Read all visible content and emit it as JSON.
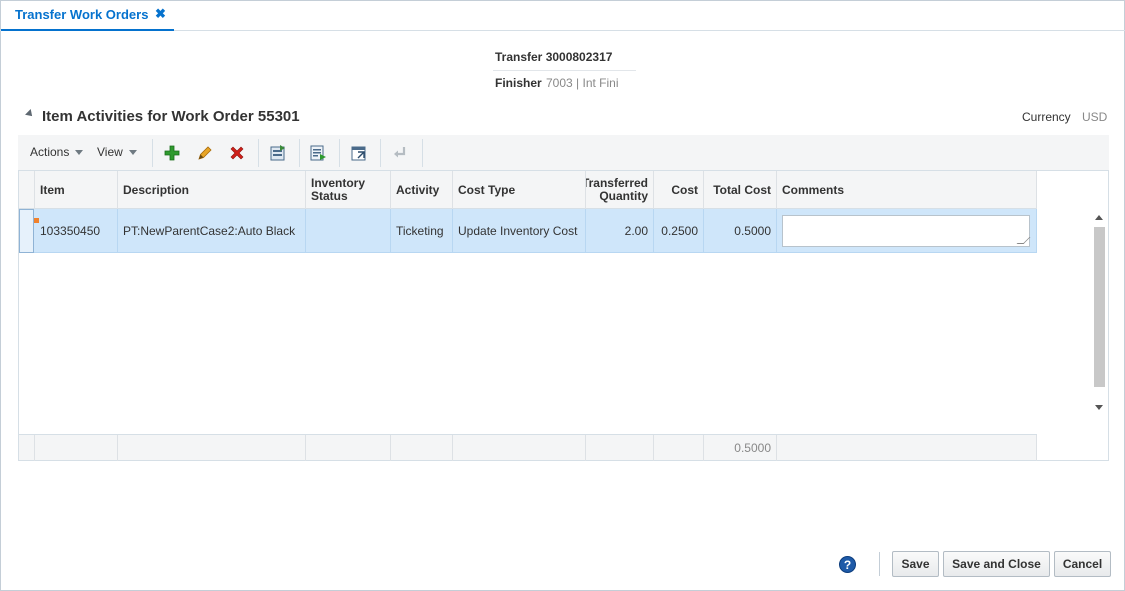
{
  "tab": {
    "title": "Transfer Work Orders",
    "close": "✖"
  },
  "header": {
    "transfer": "Transfer 3000802317",
    "finisher_label": "Finisher",
    "finisher_value": "7003 | Int Fini"
  },
  "section": {
    "title": "Item Activities for Work Order 55301",
    "currency_label": "Currency",
    "currency_value": "USD"
  },
  "toolbar": {
    "actions_label": "Actions",
    "view_label": "View",
    "icons": [
      "add-icon",
      "edit-icon",
      "delete-icon",
      "apply-icon",
      "update-icon",
      "detach-icon",
      "wrap-icon"
    ]
  },
  "table": {
    "columns": {
      "item": "Item",
      "description": "Description",
      "inventory_status": "Inventory Status",
      "activity": "Activity",
      "cost_type": "Cost Type",
      "transferred_quantity": "Transferred Quantity",
      "cost": "Cost",
      "total_cost": "Total Cost",
      "comments": "Comments"
    },
    "rows": [
      {
        "item": "103350450",
        "description": "PT:NewParentCase2:Auto Black",
        "inventory_status": "",
        "activity": "Ticketing",
        "cost_type": "Update Inventory Cost",
        "transferred_quantity": "2.00",
        "cost": "0.2500",
        "total_cost": "0.5000",
        "comments": ""
      }
    ],
    "footer_total_cost": "0.5000"
  },
  "buttons": {
    "help": "?",
    "save": "Save",
    "save_and_close": "Save and Close",
    "cancel": "Cancel"
  },
  "colors": {
    "accent": "#0572ce",
    "selected_row": "#cfe6fa",
    "add_green": "#2e9a2e",
    "delete_red": "#d0201a"
  }
}
